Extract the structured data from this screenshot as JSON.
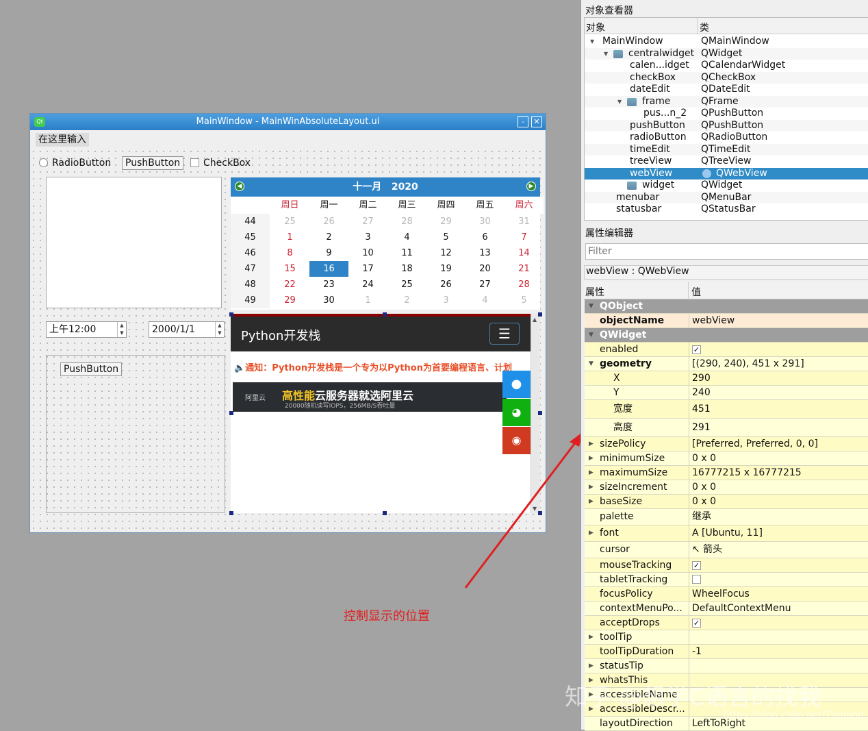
{
  "window": {
    "title": "MainWindow - MainWinAbsoluteLayout.ui",
    "minimize": "-",
    "close": "✕",
    "menu_placeholder": "在这里输入"
  },
  "form": {
    "radio_label": "RadioButton",
    "push_label": "PushButton",
    "checkbox_label": "CheckBox",
    "time_value": "上午12:00",
    "date_value": "2000/1/1",
    "frame_button": "PushButton"
  },
  "calendar": {
    "month": "十一月",
    "year": "2020",
    "weekdays": [
      "周日",
      "周一",
      "周二",
      "周三",
      "周四",
      "周五",
      "周六"
    ],
    "weeks": [
      {
        "n": "44",
        "days": [
          "25",
          "26",
          "27",
          "28",
          "29",
          "30",
          "31"
        ]
      },
      {
        "n": "45",
        "days": [
          "1",
          "2",
          "3",
          "4",
          "5",
          "6",
          "7"
        ]
      },
      {
        "n": "46",
        "days": [
          "8",
          "9",
          "10",
          "11",
          "12",
          "13",
          "14"
        ]
      },
      {
        "n": "47",
        "days": [
          "15",
          "16",
          "17",
          "18",
          "19",
          "20",
          "21"
        ]
      },
      {
        "n": "48",
        "days": [
          "22",
          "23",
          "24",
          "25",
          "26",
          "27",
          "28"
        ]
      },
      {
        "n": "49",
        "days": [
          "29",
          "30",
          "1",
          "2",
          "3",
          "4",
          "5"
        ]
      }
    ],
    "selected": "16",
    "accent": "#2e84c6",
    "weekend_color": "#cc1f2f"
  },
  "webview": {
    "site_title": "Python开发栈",
    "notice": "通知：Python开发栈是一个专为以Python为首要编程语言、计划",
    "banner_logo": "阿里云",
    "banner_title_highlight": "高性能",
    "banner_title": "云服务器就选阿里云",
    "banner_sub": "20000随机读写IOPS，256MB/S吞吐量",
    "notice_color": "#e8502a"
  },
  "annotation": {
    "text": "控制显示的位置",
    "color": "#e02020"
  },
  "object_inspector": {
    "title": "对象查看器",
    "col_object": "对象",
    "col_class": "类",
    "rows": [
      {
        "name": "MainWindow",
        "cls": "QMainWindow",
        "lvl": 0,
        "exp": true
      },
      {
        "name": "centralwidget",
        "cls": "QWidget",
        "lvl": 1,
        "exp": true,
        "icon": true
      },
      {
        "name": "calen...idget",
        "cls": "QCalendarWidget",
        "lvl": 2
      },
      {
        "name": "checkBox",
        "cls": "QCheckBox",
        "lvl": 2
      },
      {
        "name": "dateEdit",
        "cls": "QDateEdit",
        "lvl": 2
      },
      {
        "name": "frame",
        "cls": "QFrame",
        "lvl": 2,
        "exp": true,
        "icon": true
      },
      {
        "name": "pus...n_2",
        "cls": "QPushButton",
        "lvl": 3
      },
      {
        "name": "pushButton",
        "cls": "QPushButton",
        "lvl": 2
      },
      {
        "name": "radioButton",
        "cls": "QRadioButton",
        "lvl": 2
      },
      {
        "name": "timeEdit",
        "cls": "QTimeEdit",
        "lvl": 2
      },
      {
        "name": "treeView",
        "cls": "QTreeView",
        "lvl": 2
      },
      {
        "name": "webView",
        "cls": "QWebView",
        "lvl": 2,
        "sel": true
      },
      {
        "name": "widget",
        "cls": "QWidget",
        "lvl": 2,
        "icon": true
      },
      {
        "name": "menubar",
        "cls": "QMenuBar",
        "lvl": 1
      },
      {
        "name": "statusbar",
        "cls": "QStatusBar",
        "lvl": 1
      }
    ]
  },
  "property_editor": {
    "title": "属性编辑器",
    "filter_placeholder": "Filter",
    "object_label": "webView : QWebView",
    "col_prop": "属性",
    "col_value": "值",
    "rows": [
      {
        "k": "QObject",
        "grp": true
      },
      {
        "k": "objectName",
        "v": "webView",
        "bold": true,
        "peach": true
      },
      {
        "k": "QWidget",
        "grp": true
      },
      {
        "k": "enabled",
        "check": true
      },
      {
        "k": "geometry",
        "v": "[(290, 240), 451 x 291]",
        "bold": true,
        "exp": "open"
      },
      {
        "k": "X",
        "v": "290",
        "sub": true
      },
      {
        "k": "Y",
        "v": "240",
        "sub": true
      },
      {
        "k": "宽度",
        "v": "451",
        "sub": true,
        "tall": true
      },
      {
        "k": "高度",
        "v": "291",
        "sub": true,
        "tall": true
      },
      {
        "k": "sizePolicy",
        "v": "[Preferred, Preferred, 0, 0]",
        "exp": "closed"
      },
      {
        "k": "minimumSize",
        "v": "0 x 0",
        "exp": "closed"
      },
      {
        "k": "maximumSize",
        "v": "16777215 x 16777215",
        "exp": "closed"
      },
      {
        "k": "sizeIncrement",
        "v": "0 x 0",
        "exp": "closed"
      },
      {
        "k": "baseSize",
        "v": "0 x 0",
        "exp": "closed"
      },
      {
        "k": "palette",
        "v": "继承",
        "tall": true
      },
      {
        "k": "font",
        "v": "A  [Ubuntu, 11]",
        "exp": "closed",
        "tall": true
      },
      {
        "k": "cursor",
        "v": "↖  箭头",
        "tall": true
      },
      {
        "k": "mouseTracking",
        "check": true
      },
      {
        "k": "tabletTracking",
        "check": false
      },
      {
        "k": "focusPolicy",
        "v": "WheelFocus"
      },
      {
        "k": "contextMenuPo...",
        "v": "DefaultContextMenu"
      },
      {
        "k": "acceptDrops",
        "check": true
      },
      {
        "k": "toolTip",
        "v": "",
        "exp": "closed"
      },
      {
        "k": "toolTipDuration",
        "v": "-1"
      },
      {
        "k": "statusTip",
        "v": "",
        "exp": "closed"
      },
      {
        "k": "whatsThis",
        "v": "",
        "exp": "closed"
      },
      {
        "k": "accessibleName",
        "v": "",
        "exp": "closed"
      },
      {
        "k": "accessibleDescr...",
        "v": "",
        "exp": "closed"
      },
      {
        "k": "layoutDirection",
        "v": "LeftToRight"
      }
    ]
  },
  "watermark": {
    "text": "知乎 @想学C语言的找我",
    "url": "https://blog.csdn.net/Thanlon"
  }
}
